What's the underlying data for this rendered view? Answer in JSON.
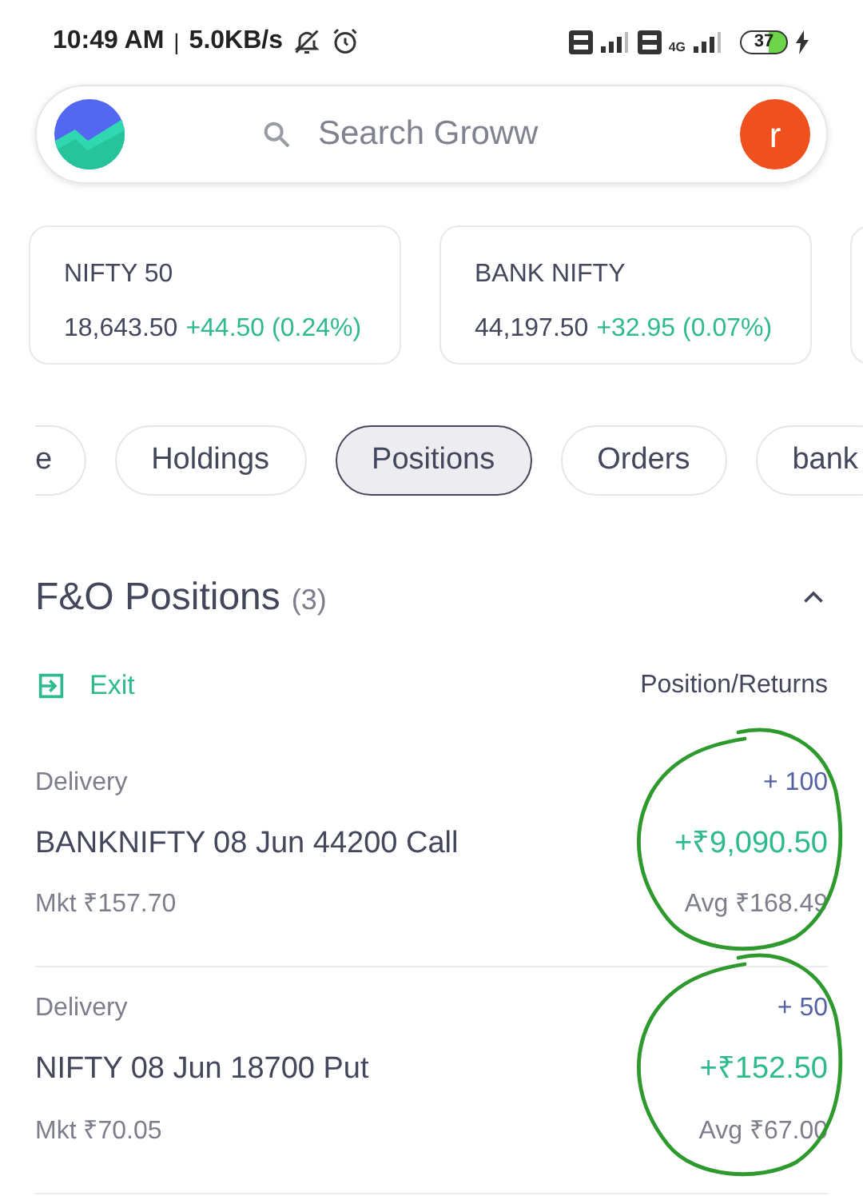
{
  "status_bar": {
    "time": "10:49 AM",
    "separator": "|",
    "speed": "5.0KB/s",
    "network": "4G",
    "battery": "37"
  },
  "search": {
    "placeholder": "Search Groww",
    "avatar": "r"
  },
  "indices": [
    {
      "name": "NIFTY 50",
      "value": "18,643.50",
      "change": "+44.50 (0.24%)"
    },
    {
      "name": "BANK NIFTY",
      "value": "44,197.50",
      "change": "+32.95 (0.07%)"
    }
  ],
  "chips": [
    {
      "label": "e",
      "selected": false
    },
    {
      "label": "Holdings",
      "selected": false
    },
    {
      "label": "Positions",
      "selected": true
    },
    {
      "label": "Orders",
      "selected": false
    },
    {
      "label": "bank",
      "selected": false
    }
  ],
  "section": {
    "title": "F&O Positions",
    "count": "(3)",
    "expanded": true,
    "exit_label": "Exit",
    "column_label": "Position/Returns"
  },
  "positions": [
    {
      "product": "Delivery",
      "name": "BANKNIFTY 08 Jun 44200 Call",
      "market": "Mkt ₹157.70",
      "quantity": "+ 100",
      "returns": "+₹9,090.50",
      "average": "Avg ₹168.49"
    },
    {
      "product": "Delivery",
      "name": "NIFTY 08 Jun 18700 Put",
      "market": "Mkt ₹70.05",
      "quantity": "+ 50",
      "returns": "+₹152.50",
      "average": "Avg ₹67.00"
    }
  ]
}
